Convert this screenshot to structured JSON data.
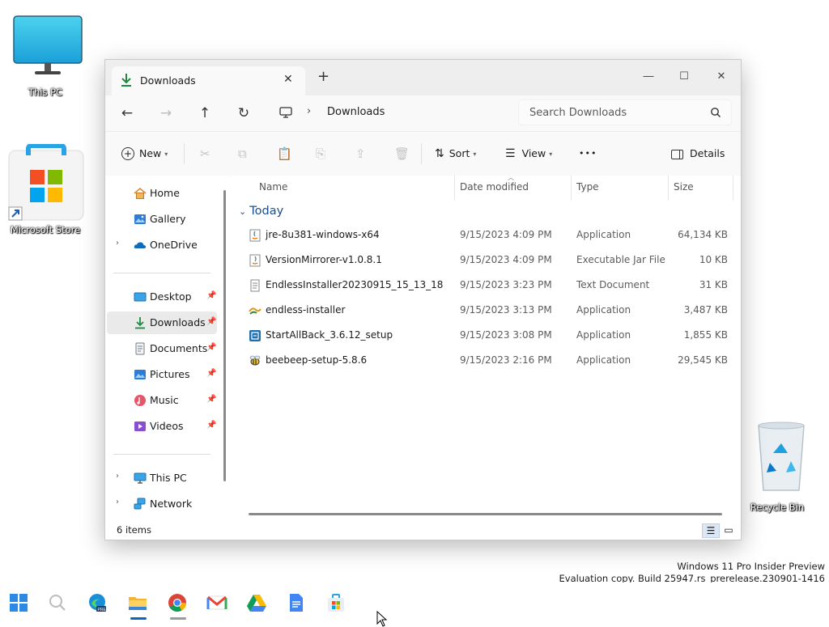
{
  "desktop": {
    "icons": [
      {
        "label": "This PC",
        "icon": "monitor-icon"
      },
      {
        "label": "Microsoft Store",
        "icon": "store-icon"
      },
      {
        "label": "Recycle Bin",
        "icon": "recycle-bin-icon"
      }
    ],
    "watermark": {
      "line1": "Windows 11 Pro Insider Preview",
      "line2": "Evaluation copy. Build 25947.rs_prerelease.230901-1416"
    }
  },
  "window": {
    "tab": {
      "label": "Downloads",
      "icon": "download-arrow-icon"
    },
    "address": {
      "location": "Downloads",
      "root_icon": "monitor-icon"
    },
    "search": {
      "placeholder": "Search Downloads"
    },
    "toolbar": {
      "new_label": "New",
      "sort_label": "Sort",
      "view_label": "View",
      "more_label": "•••",
      "details_label": "Details"
    },
    "sidebar": {
      "items": [
        {
          "label": "Home",
          "icon": "home-icon"
        },
        {
          "label": "Gallery",
          "icon": "gallery-icon"
        },
        {
          "label": "OneDrive",
          "icon": "cloud-icon"
        },
        {
          "label": "Desktop",
          "icon": "desktop-icon"
        },
        {
          "label": "Downloads",
          "icon": "download-arrow-icon"
        },
        {
          "label": "Documents",
          "icon": "documents-icon"
        },
        {
          "label": "Pictures",
          "icon": "pictures-icon"
        },
        {
          "label": "Music",
          "icon": "music-icon"
        },
        {
          "label": "Videos",
          "icon": "videos-icon"
        },
        {
          "label": "This PC",
          "icon": "monitor-icon"
        },
        {
          "label": "Network",
          "icon": "network-icon"
        }
      ]
    },
    "columns": {
      "name": "Name",
      "date": "Date modified",
      "type": "Type",
      "size": "Size"
    },
    "group_label": "Today",
    "files": [
      {
        "name": "jre-8u381-windows-x64",
        "date": "9/15/2023 4:09 PM",
        "type": "Application",
        "size": "64,134 KB",
        "icon": "java-icon"
      },
      {
        "name": "VersionMirrorer-v1.0.8.1",
        "date": "9/15/2023 4:09 PM",
        "type": "Executable Jar File",
        "size": "10 KB",
        "icon": "jar-icon"
      },
      {
        "name": "EndlessInstaller20230915_15_13_18",
        "date": "9/15/2023 3:23 PM",
        "type": "Text Document",
        "size": "31 KB",
        "icon": "text-file-icon"
      },
      {
        "name": "endless-installer",
        "date": "9/15/2023 3:13 PM",
        "type": "Application",
        "size": "3,487 KB",
        "icon": "installer-icon"
      },
      {
        "name": "StartAllBack_3.6.12_setup",
        "date": "9/15/2023 3:08 PM",
        "type": "Application",
        "size": "1,855 KB",
        "icon": "setup-icon"
      },
      {
        "name": "beebeep-setup-5.8.6",
        "date": "9/15/2023 2:16 PM",
        "type": "Application",
        "size": "29,545 KB",
        "icon": "bee-icon"
      }
    ],
    "status": {
      "item_count": "6 items"
    }
  },
  "taskbar": {
    "apps": [
      "start-icon",
      "search-icon",
      "edge-icon",
      "file-explorer-icon",
      "chrome-icon",
      "gmail-icon",
      "drive-icon",
      "docs-icon",
      "store-icon"
    ]
  }
}
